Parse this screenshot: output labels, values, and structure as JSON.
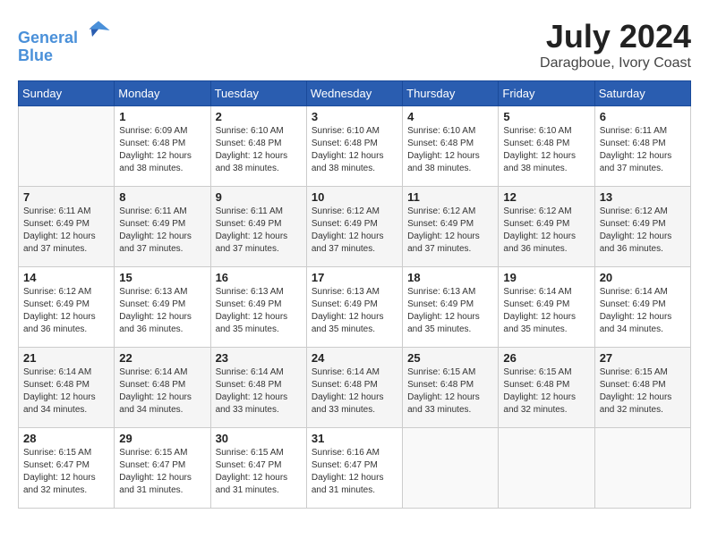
{
  "header": {
    "logo_line1": "General",
    "logo_line2": "Blue",
    "month": "July 2024",
    "location": "Daragboue, Ivory Coast"
  },
  "days_of_week": [
    "Sunday",
    "Monday",
    "Tuesday",
    "Wednesday",
    "Thursday",
    "Friday",
    "Saturday"
  ],
  "weeks": [
    [
      {
        "day": "",
        "info": ""
      },
      {
        "day": "1",
        "info": "Sunrise: 6:09 AM\nSunset: 6:48 PM\nDaylight: 12 hours\nand 38 minutes."
      },
      {
        "day": "2",
        "info": "Sunrise: 6:10 AM\nSunset: 6:48 PM\nDaylight: 12 hours\nand 38 minutes."
      },
      {
        "day": "3",
        "info": "Sunrise: 6:10 AM\nSunset: 6:48 PM\nDaylight: 12 hours\nand 38 minutes."
      },
      {
        "day": "4",
        "info": "Sunrise: 6:10 AM\nSunset: 6:48 PM\nDaylight: 12 hours\nand 38 minutes."
      },
      {
        "day": "5",
        "info": "Sunrise: 6:10 AM\nSunset: 6:48 PM\nDaylight: 12 hours\nand 38 minutes."
      },
      {
        "day": "6",
        "info": "Sunrise: 6:11 AM\nSunset: 6:48 PM\nDaylight: 12 hours\nand 37 minutes."
      }
    ],
    [
      {
        "day": "7",
        "info": "Sunrise: 6:11 AM\nSunset: 6:49 PM\nDaylight: 12 hours\nand 37 minutes."
      },
      {
        "day": "8",
        "info": "Sunrise: 6:11 AM\nSunset: 6:49 PM\nDaylight: 12 hours\nand 37 minutes."
      },
      {
        "day": "9",
        "info": "Sunrise: 6:11 AM\nSunset: 6:49 PM\nDaylight: 12 hours\nand 37 minutes."
      },
      {
        "day": "10",
        "info": "Sunrise: 6:12 AM\nSunset: 6:49 PM\nDaylight: 12 hours\nand 37 minutes."
      },
      {
        "day": "11",
        "info": "Sunrise: 6:12 AM\nSunset: 6:49 PM\nDaylight: 12 hours\nand 37 minutes."
      },
      {
        "day": "12",
        "info": "Sunrise: 6:12 AM\nSunset: 6:49 PM\nDaylight: 12 hours\nand 36 minutes."
      },
      {
        "day": "13",
        "info": "Sunrise: 6:12 AM\nSunset: 6:49 PM\nDaylight: 12 hours\nand 36 minutes."
      }
    ],
    [
      {
        "day": "14",
        "info": "Sunrise: 6:12 AM\nSunset: 6:49 PM\nDaylight: 12 hours\nand 36 minutes."
      },
      {
        "day": "15",
        "info": "Sunrise: 6:13 AM\nSunset: 6:49 PM\nDaylight: 12 hours\nand 36 minutes."
      },
      {
        "day": "16",
        "info": "Sunrise: 6:13 AM\nSunset: 6:49 PM\nDaylight: 12 hours\nand 35 minutes."
      },
      {
        "day": "17",
        "info": "Sunrise: 6:13 AM\nSunset: 6:49 PM\nDaylight: 12 hours\nand 35 minutes."
      },
      {
        "day": "18",
        "info": "Sunrise: 6:13 AM\nSunset: 6:49 PM\nDaylight: 12 hours\nand 35 minutes."
      },
      {
        "day": "19",
        "info": "Sunrise: 6:14 AM\nSunset: 6:49 PM\nDaylight: 12 hours\nand 35 minutes."
      },
      {
        "day": "20",
        "info": "Sunrise: 6:14 AM\nSunset: 6:49 PM\nDaylight: 12 hours\nand 34 minutes."
      }
    ],
    [
      {
        "day": "21",
        "info": "Sunrise: 6:14 AM\nSunset: 6:48 PM\nDaylight: 12 hours\nand 34 minutes."
      },
      {
        "day": "22",
        "info": "Sunrise: 6:14 AM\nSunset: 6:48 PM\nDaylight: 12 hours\nand 34 minutes."
      },
      {
        "day": "23",
        "info": "Sunrise: 6:14 AM\nSunset: 6:48 PM\nDaylight: 12 hours\nand 33 minutes."
      },
      {
        "day": "24",
        "info": "Sunrise: 6:14 AM\nSunset: 6:48 PM\nDaylight: 12 hours\nand 33 minutes."
      },
      {
        "day": "25",
        "info": "Sunrise: 6:15 AM\nSunset: 6:48 PM\nDaylight: 12 hours\nand 33 minutes."
      },
      {
        "day": "26",
        "info": "Sunrise: 6:15 AM\nSunset: 6:48 PM\nDaylight: 12 hours\nand 32 minutes."
      },
      {
        "day": "27",
        "info": "Sunrise: 6:15 AM\nSunset: 6:48 PM\nDaylight: 12 hours\nand 32 minutes."
      }
    ],
    [
      {
        "day": "28",
        "info": "Sunrise: 6:15 AM\nSunset: 6:47 PM\nDaylight: 12 hours\nand 32 minutes."
      },
      {
        "day": "29",
        "info": "Sunrise: 6:15 AM\nSunset: 6:47 PM\nDaylight: 12 hours\nand 31 minutes."
      },
      {
        "day": "30",
        "info": "Sunrise: 6:15 AM\nSunset: 6:47 PM\nDaylight: 12 hours\nand 31 minutes."
      },
      {
        "day": "31",
        "info": "Sunrise: 6:16 AM\nSunset: 6:47 PM\nDaylight: 12 hours\nand 31 minutes."
      },
      {
        "day": "",
        "info": ""
      },
      {
        "day": "",
        "info": ""
      },
      {
        "day": "",
        "info": ""
      }
    ]
  ]
}
